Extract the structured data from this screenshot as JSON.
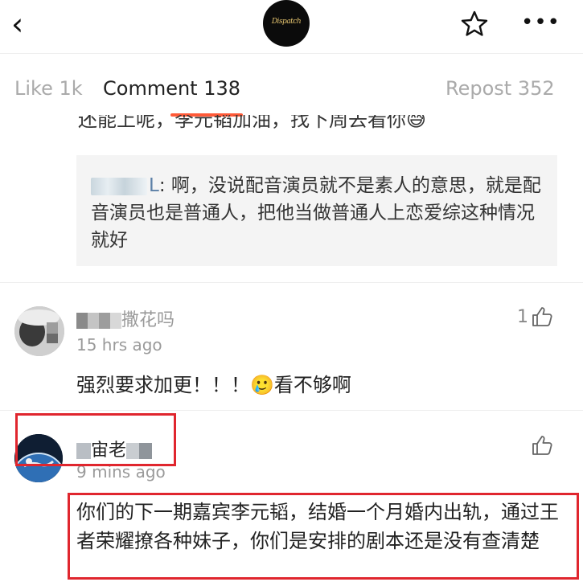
{
  "header": {
    "back_glyph": "‹",
    "avatar_logo_text": "Dispatch",
    "more_glyph": "•••"
  },
  "tabs": [
    {
      "label": "Like 1k"
    },
    {
      "label": "Comment 138"
    },
    {
      "label": "Repost 352"
    }
  ],
  "partial_comment": {
    "text": "还能上呢，李元韬加油，找下周去看你😅"
  },
  "quoted_reply": {
    "name_visible_fragment": "L",
    "text": ": 啊，没说配音演员就不是素人的意思，就是配音演员也是普通人，把他当做普通人上恋爱综这种情况就好"
  },
  "comments": [
    {
      "name_visible_fragment": "撒花吗",
      "time": "15 hrs ago",
      "likes": "1",
      "text": "强烈要求加更！！！🥲看不够啊"
    },
    {
      "name_visible_fragment": "宙老",
      "time": "9 mins ago",
      "likes": "",
      "text": "你们的下一期嘉宾李元韬，结婚一个月婚内出轨，通过王者荣耀撩各种妹子，你们是安排的剧本还是没有查清楚"
    }
  ],
  "colors": {
    "accent_underline": "#ff5a38",
    "annotation_red": "#e0262e",
    "tab_inactive": "#aaaaaa"
  },
  "icons": [
    "back-icon",
    "star-icon",
    "more-icon",
    "thumb-up-icon"
  ]
}
